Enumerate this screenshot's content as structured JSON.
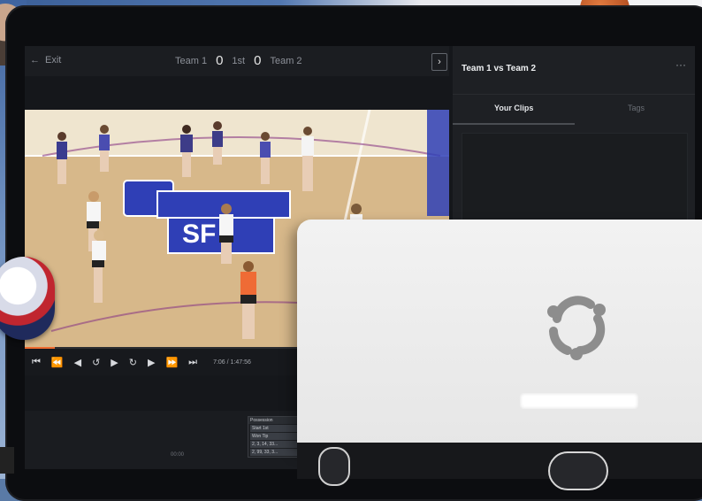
{
  "video_header": {
    "exit_label": "Exit",
    "team1": "Team 1",
    "team1_score": "0",
    "period": "1st",
    "team2_score": "0",
    "team2": "Team 2",
    "next_icon": "chevron-right-icon"
  },
  "player": {
    "timecode": "7:06 / 1:47:56",
    "progress_fraction": 0.07,
    "controls": [
      "skip-start-icon",
      "rewind-icon",
      "step-back-icon",
      "replay-icon",
      "play-icon",
      "forward-icon",
      "step-forward-icon",
      "fast-forward-icon",
      "skip-end-icon"
    ]
  },
  "timeline": {
    "time_label": "00:00",
    "tags": {
      "header": "Possession",
      "items": [
        "Start 1st",
        "Won Tip",
        "2, 3, 14, 33...",
        "2, 99, 33, 3..."
      ]
    }
  },
  "panel": {
    "title": "Team 1 vs Team 2",
    "more_icon": "ellipsis-icon",
    "tabs": [
      "Your Clips",
      "Tags"
    ]
  },
  "colors": {
    "accent": "#ee6b2f",
    "panel_bg": "#1e2024",
    "court_blue": "#2f3fb6"
  }
}
